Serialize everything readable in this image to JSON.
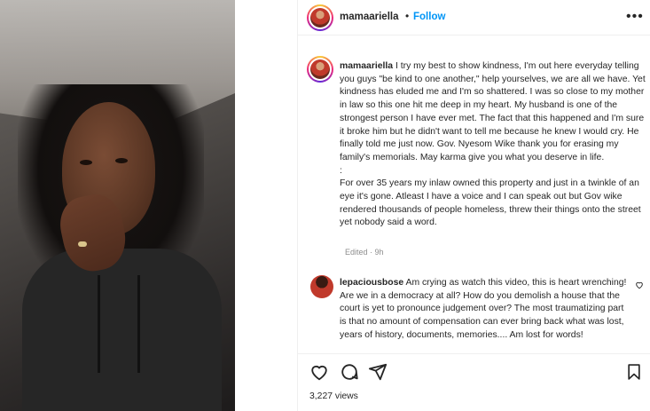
{
  "post": {
    "username": "mamaariella",
    "follow_label": "Follow",
    "separator": "•",
    "more_label": "•••",
    "caption_paragraphs": [
      "I try my best to show kindness, I'm out here everyday telling you guys \"be kind to one another,\" help yourselves, we are all we have. Yet kindness has eluded me and I'm so shattered. I was so close to my mother in law so this one hit me deep in my heart. My husband is one of the strongest person I have ever met. The fact that this happened and I'm sure it broke him but he didn't want to tell me because he knew I would cry. He finally told me just now. Gov. Nyesom Wike thank you for erasing my family's memorials. May karma give you what you deserve in life.",
      ":",
      "For over 35 years my inlaw owned this property and just in a twinkle of an eye it's gone. Atleast I have a voice and I can speak out but Gov wike rendered thousands of people homeless, threw their things onto the street yet nobody said a word."
    ],
    "edited_label": "Edited · 9h",
    "views": "3,227 views"
  },
  "comment": {
    "username": "lepaciousbose",
    "text": "Am crying as watch this video, this is heart wrenching! Are we in a democracy at all? How do you demolish a house that the court is yet to pronounce judgement over? The most traumatizing part is that no amount of compensation can ever bring back what was lost, years of history, documents, memories.... Am lost for words!"
  },
  "icons": {
    "like": "heart-icon",
    "comment": "comment-icon",
    "share": "share-icon",
    "save": "bookmark-icon",
    "more": "more-icon",
    "comment_like": "heart-icon"
  }
}
